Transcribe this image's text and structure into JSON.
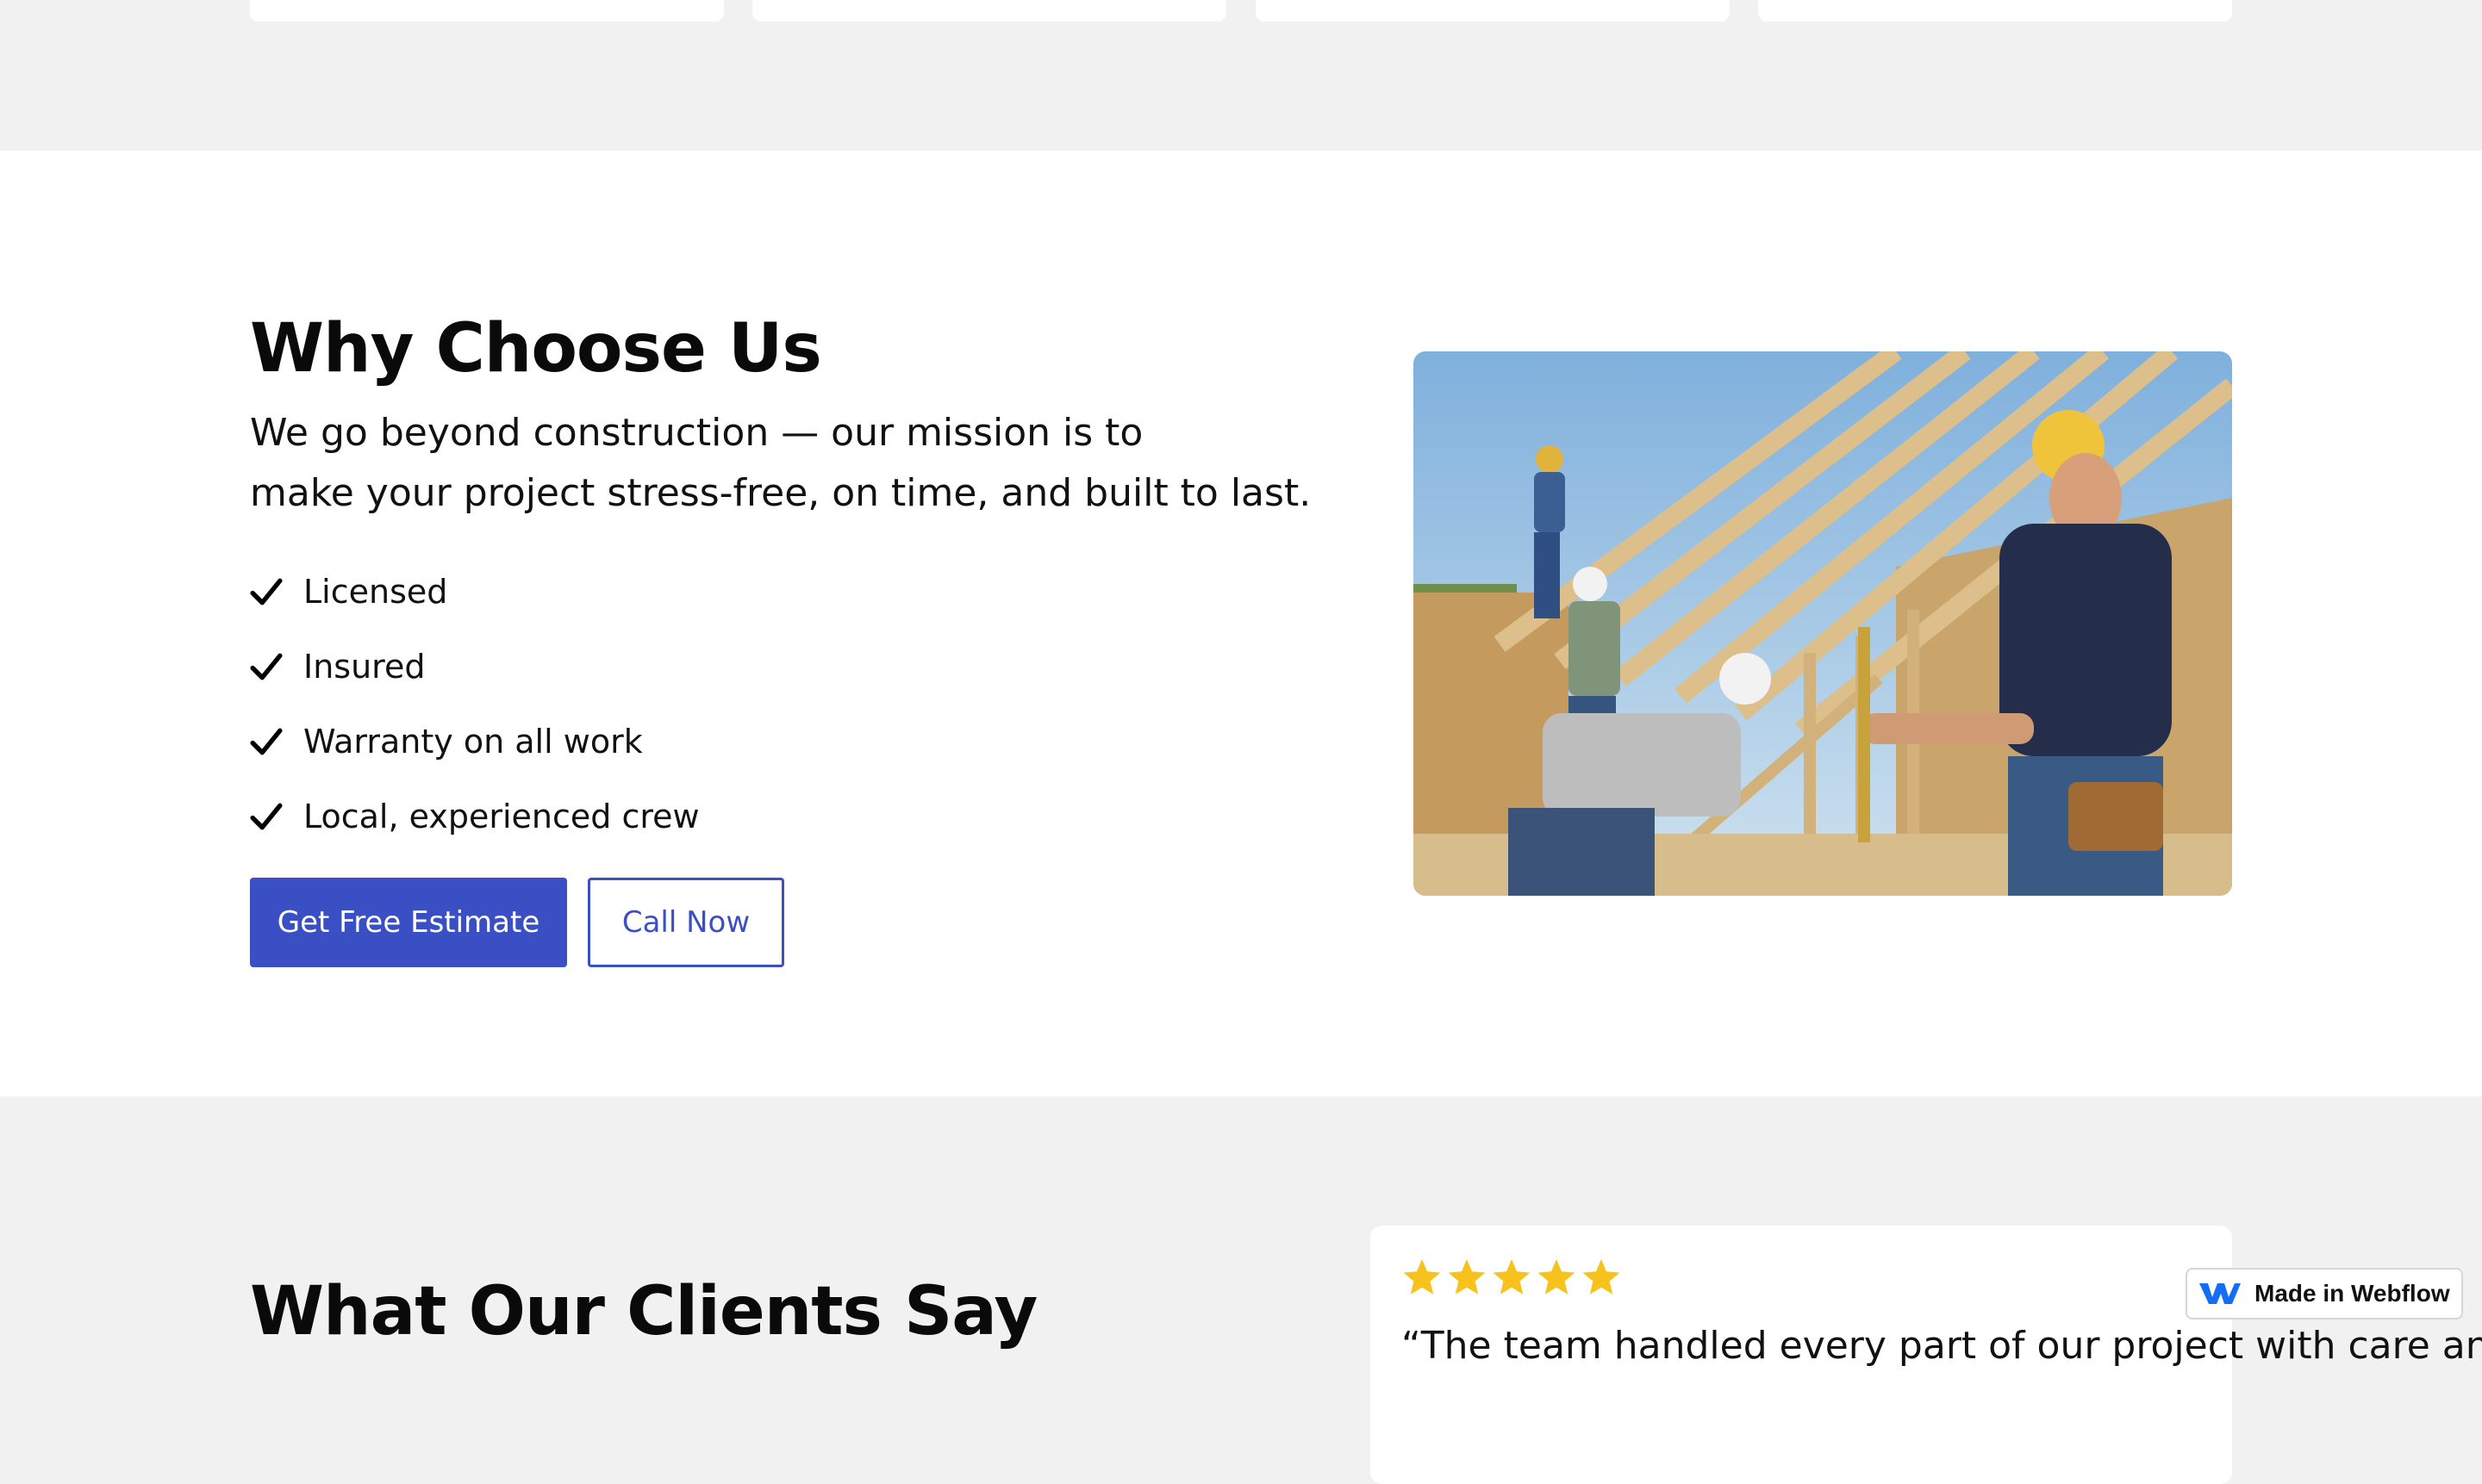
{
  "why": {
    "title": "Why Choose Us",
    "description_line1": "We go beyond construction — our mission is to",
    "description_line2": "make your project stress-free, on time, and built to last.",
    "features": [
      {
        "label": "Licensed",
        "icon": "checkmark-icon"
      },
      {
        "label": "Insured",
        "icon": "checkmark-icon"
      },
      {
        "label": "Warranty on all work",
        "icon": "checkmark-icon"
      },
      {
        "label": "Local, experienced crew",
        "icon": "checkmark-icon"
      }
    ],
    "primary_button": "Get Free Estimate",
    "secondary_button": "Call Now"
  },
  "testimonials": {
    "title": "What Our Clients Say",
    "rating": 5,
    "quote_preview": "“The team handled every part of our project with care and"
  },
  "badge": {
    "label": "Made in Webflow"
  },
  "colors": {
    "accent": "#3b4fc4",
    "star": "#f7c21b",
    "page_background": "#f1f1f1",
    "section_background": "#ffffff"
  }
}
